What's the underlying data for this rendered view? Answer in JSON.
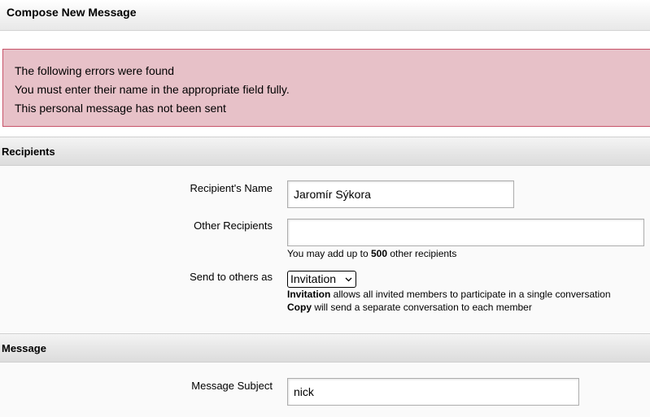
{
  "page": {
    "title": "Compose New Message"
  },
  "errors": {
    "lines": [
      "The following errors were found",
      "You must enter their name in the appropriate field fully.",
      "This personal message has not been sent"
    ]
  },
  "recipients": {
    "heading": "Recipients",
    "name_label": "Recipient's Name",
    "name_value": "Jaromír Sýkora",
    "other_label": "Other Recipients",
    "other_value": "",
    "limit_hint": {
      "prefix": "You may add up to ",
      "count": "500",
      "suffix": " other recipients"
    },
    "send_as_label": "Send to others as",
    "send_as_selected": "Invitation",
    "invitation_help": {
      "term": "Invitation",
      "text": " allows all invited members to participate in a single conversation"
    },
    "copy_help": {
      "term": "Copy",
      "text": " will send a separate conversation to each member"
    }
  },
  "message": {
    "heading": "Message",
    "subject_label": "Message Subject",
    "subject_value": "nick"
  }
}
